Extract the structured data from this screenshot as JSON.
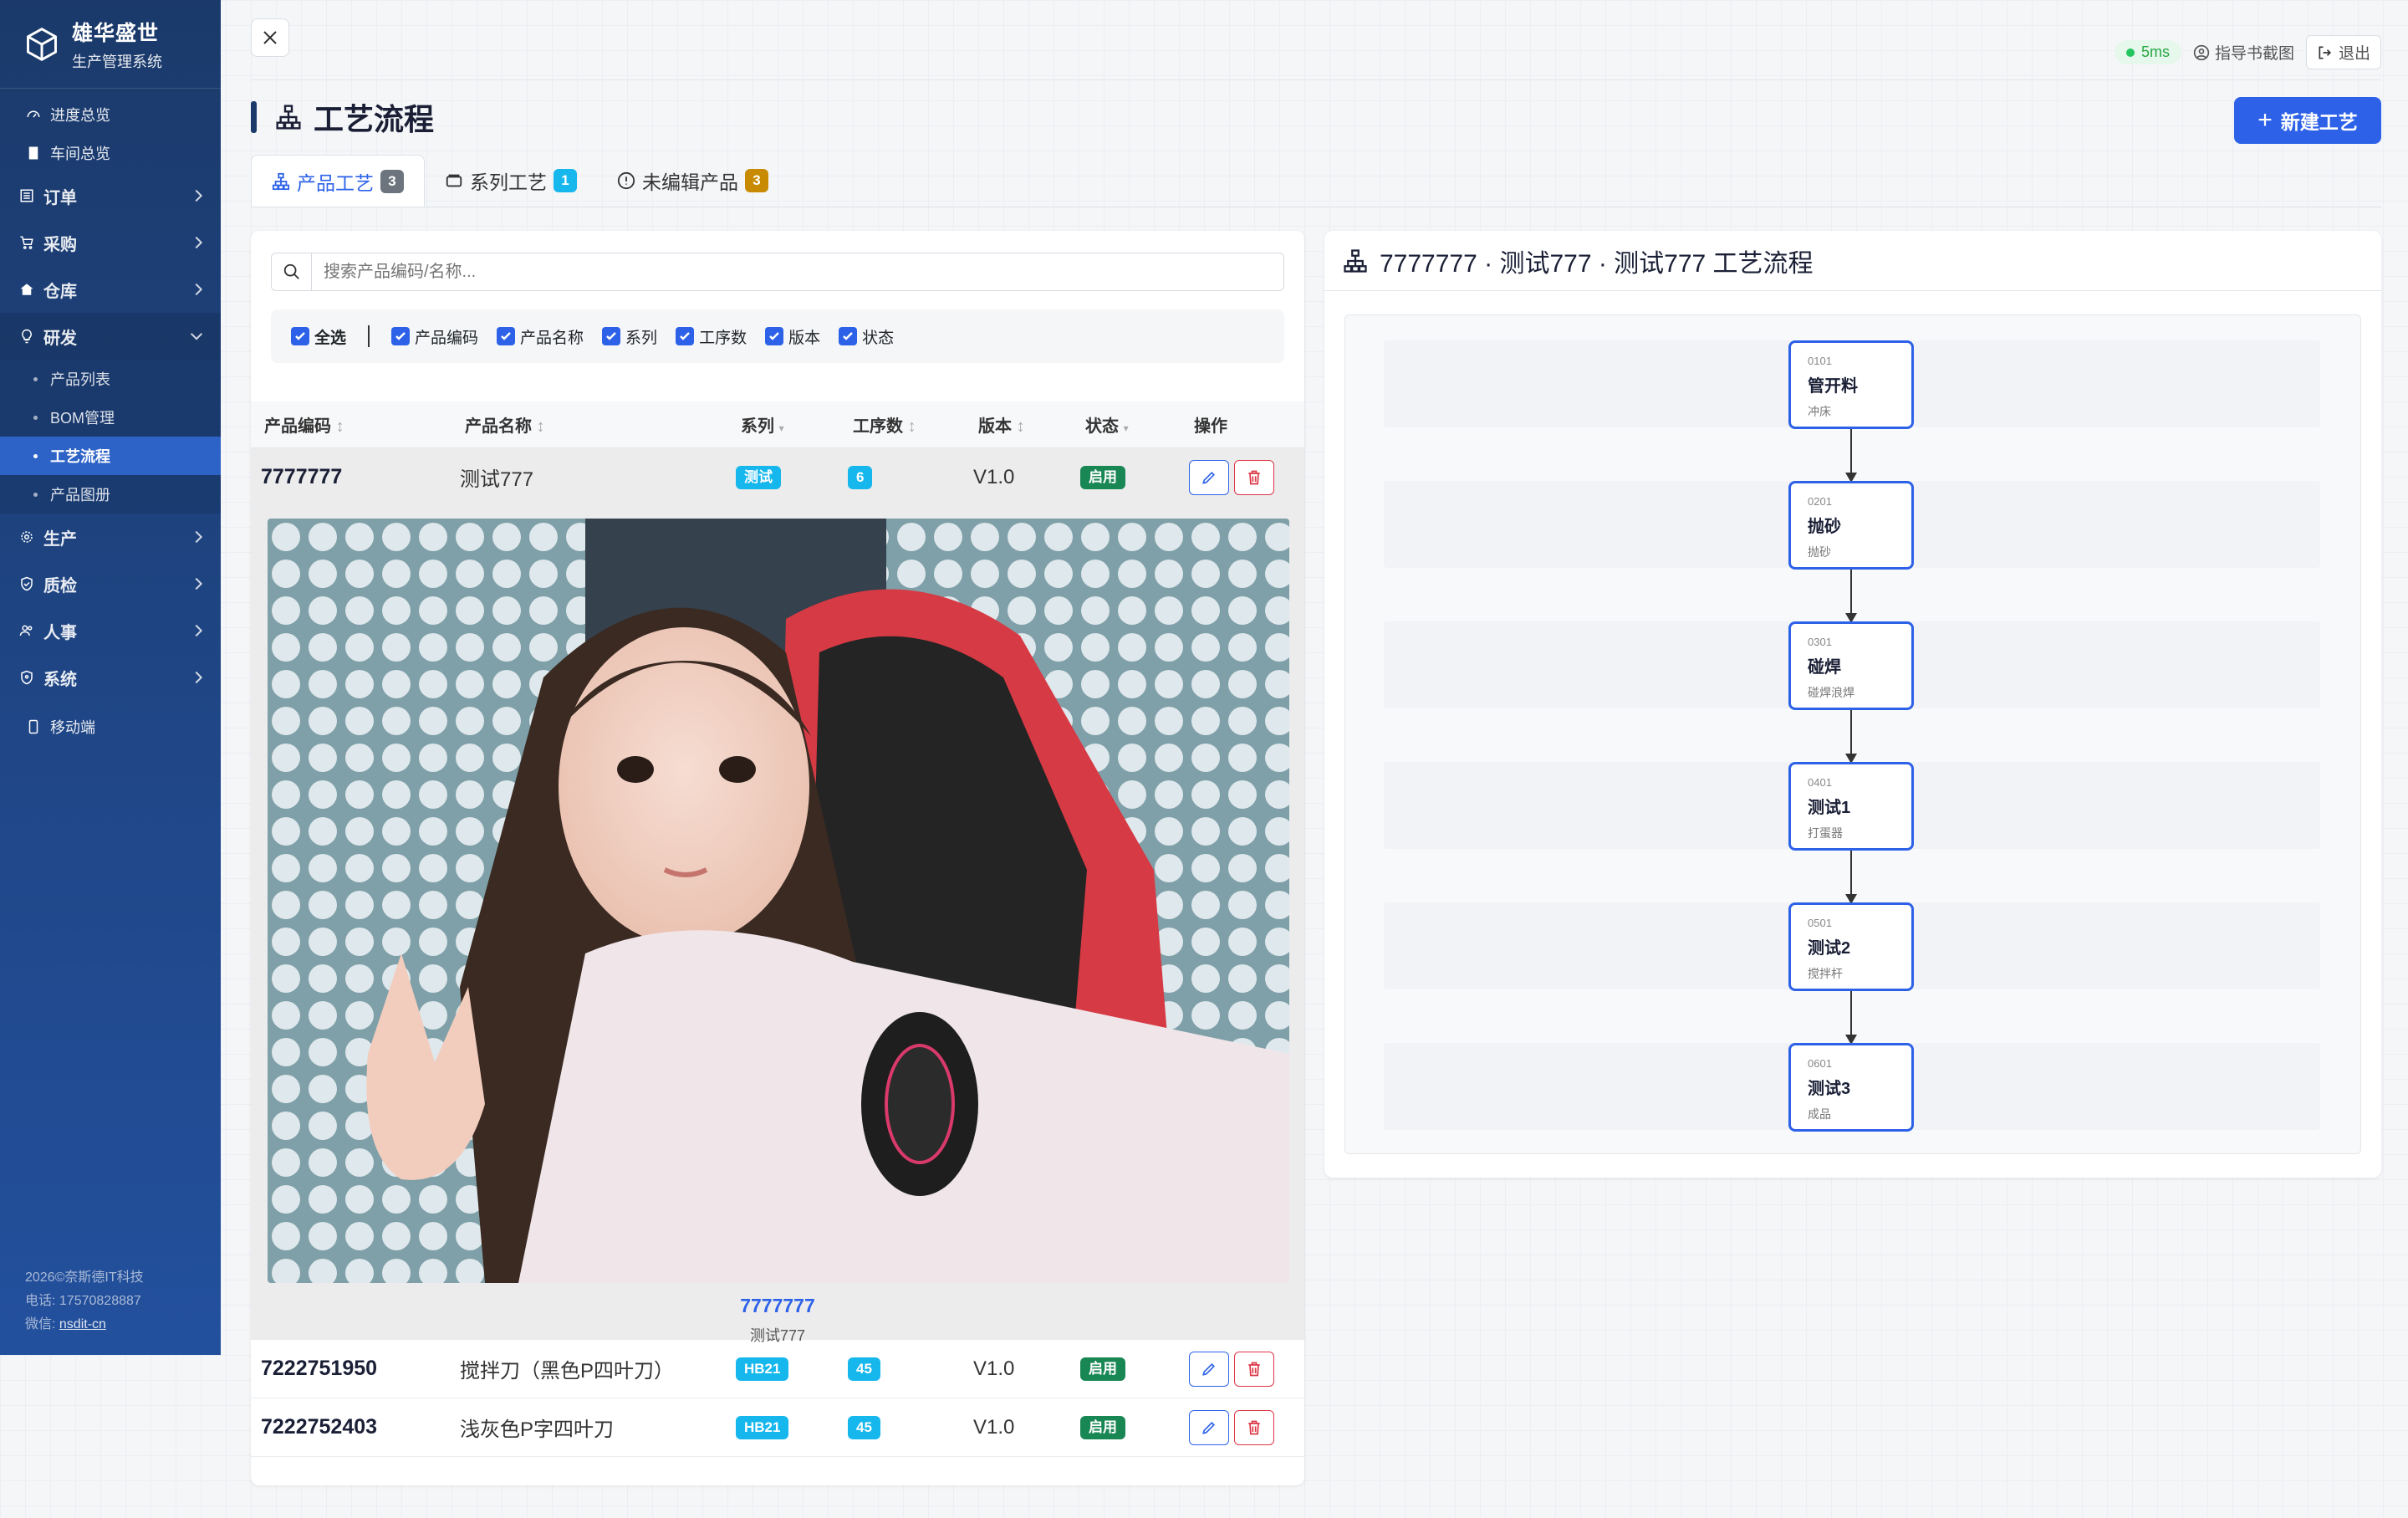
{
  "brand": {
    "title": "雄华盛世",
    "subtitle": "生产管理系统"
  },
  "nav": {
    "overview": "进度总览",
    "workshop": "车间总览",
    "orders": "订单",
    "purchase": "采购",
    "warehouse": "仓库",
    "rd": "研发",
    "rd_sub": [
      "产品列表",
      "BOM管理",
      "工艺流程",
      "产品图册"
    ],
    "production": "生产",
    "qc": "质检",
    "hr": "人事",
    "system": "系统",
    "mobile": "移动端"
  },
  "footer": {
    "copyright": "2026©奈斯德IT科技",
    "phone_label": "电话:",
    "phone": "17570828887",
    "wechat_label": "微信:",
    "wechat": "nsdit-cn"
  },
  "topbar": {
    "latency": "5ms",
    "guide": "指导书截图",
    "logout": "退出"
  },
  "page": {
    "title": "工艺流程",
    "new_button": "新建工艺"
  },
  "tabs": [
    {
      "label": "产品工艺",
      "count": "3"
    },
    {
      "label": "系列工艺",
      "count": "1"
    },
    {
      "label": "未编辑产品",
      "count": "3"
    }
  ],
  "search": {
    "placeholder": "搜索产品编码/名称..."
  },
  "filters": {
    "all": "全选",
    "items": [
      "产品编码",
      "产品名称",
      "系列",
      "工序数",
      "版本",
      "状态"
    ]
  },
  "table": {
    "headers": [
      "产品编码",
      "产品名称",
      "系列",
      "工序数",
      "版本",
      "状态",
      "操作"
    ],
    "rows": [
      {
        "code": "7777777",
        "name": "测试777",
        "series": "测试",
        "steps": "6",
        "version": "V1.0",
        "status": "启用"
      },
      {
        "code": "7222751950",
        "name": "搅拌刀（黑色P四叶刀）",
        "series": "HB21",
        "steps": "45",
        "version": "V1.0",
        "status": "启用"
      },
      {
        "code": "7222752403",
        "name": "浅灰色P字四叶刀",
        "series": "HB21",
        "steps": "45",
        "version": "V1.0",
        "status": "启用"
      }
    ],
    "expanded": {
      "code": "7777777",
      "name": "测试777"
    }
  },
  "flow": {
    "title": "7777777 · 测试777 · 测试777 工艺流程",
    "nodes": [
      {
        "code": "0101",
        "name": "管开料",
        "sub": "冲床"
      },
      {
        "code": "0201",
        "name": "抛砂",
        "sub": "抛砂"
      },
      {
        "code": "0301",
        "name": "碰焊",
        "sub": "碰焊浪焊"
      },
      {
        "code": "0401",
        "name": "测试1",
        "sub": "打蛋器"
      },
      {
        "code": "0501",
        "name": "测试2",
        "sub": "搅拌杆"
      },
      {
        "code": "0601",
        "name": "测试3",
        "sub": "成品"
      }
    ]
  },
  "colors": {
    "primary": "#2d62e8",
    "sidebar": "#1b3a6b",
    "cyan": "#16b7ed",
    "green": "#198754",
    "danger": "#dc3545"
  }
}
